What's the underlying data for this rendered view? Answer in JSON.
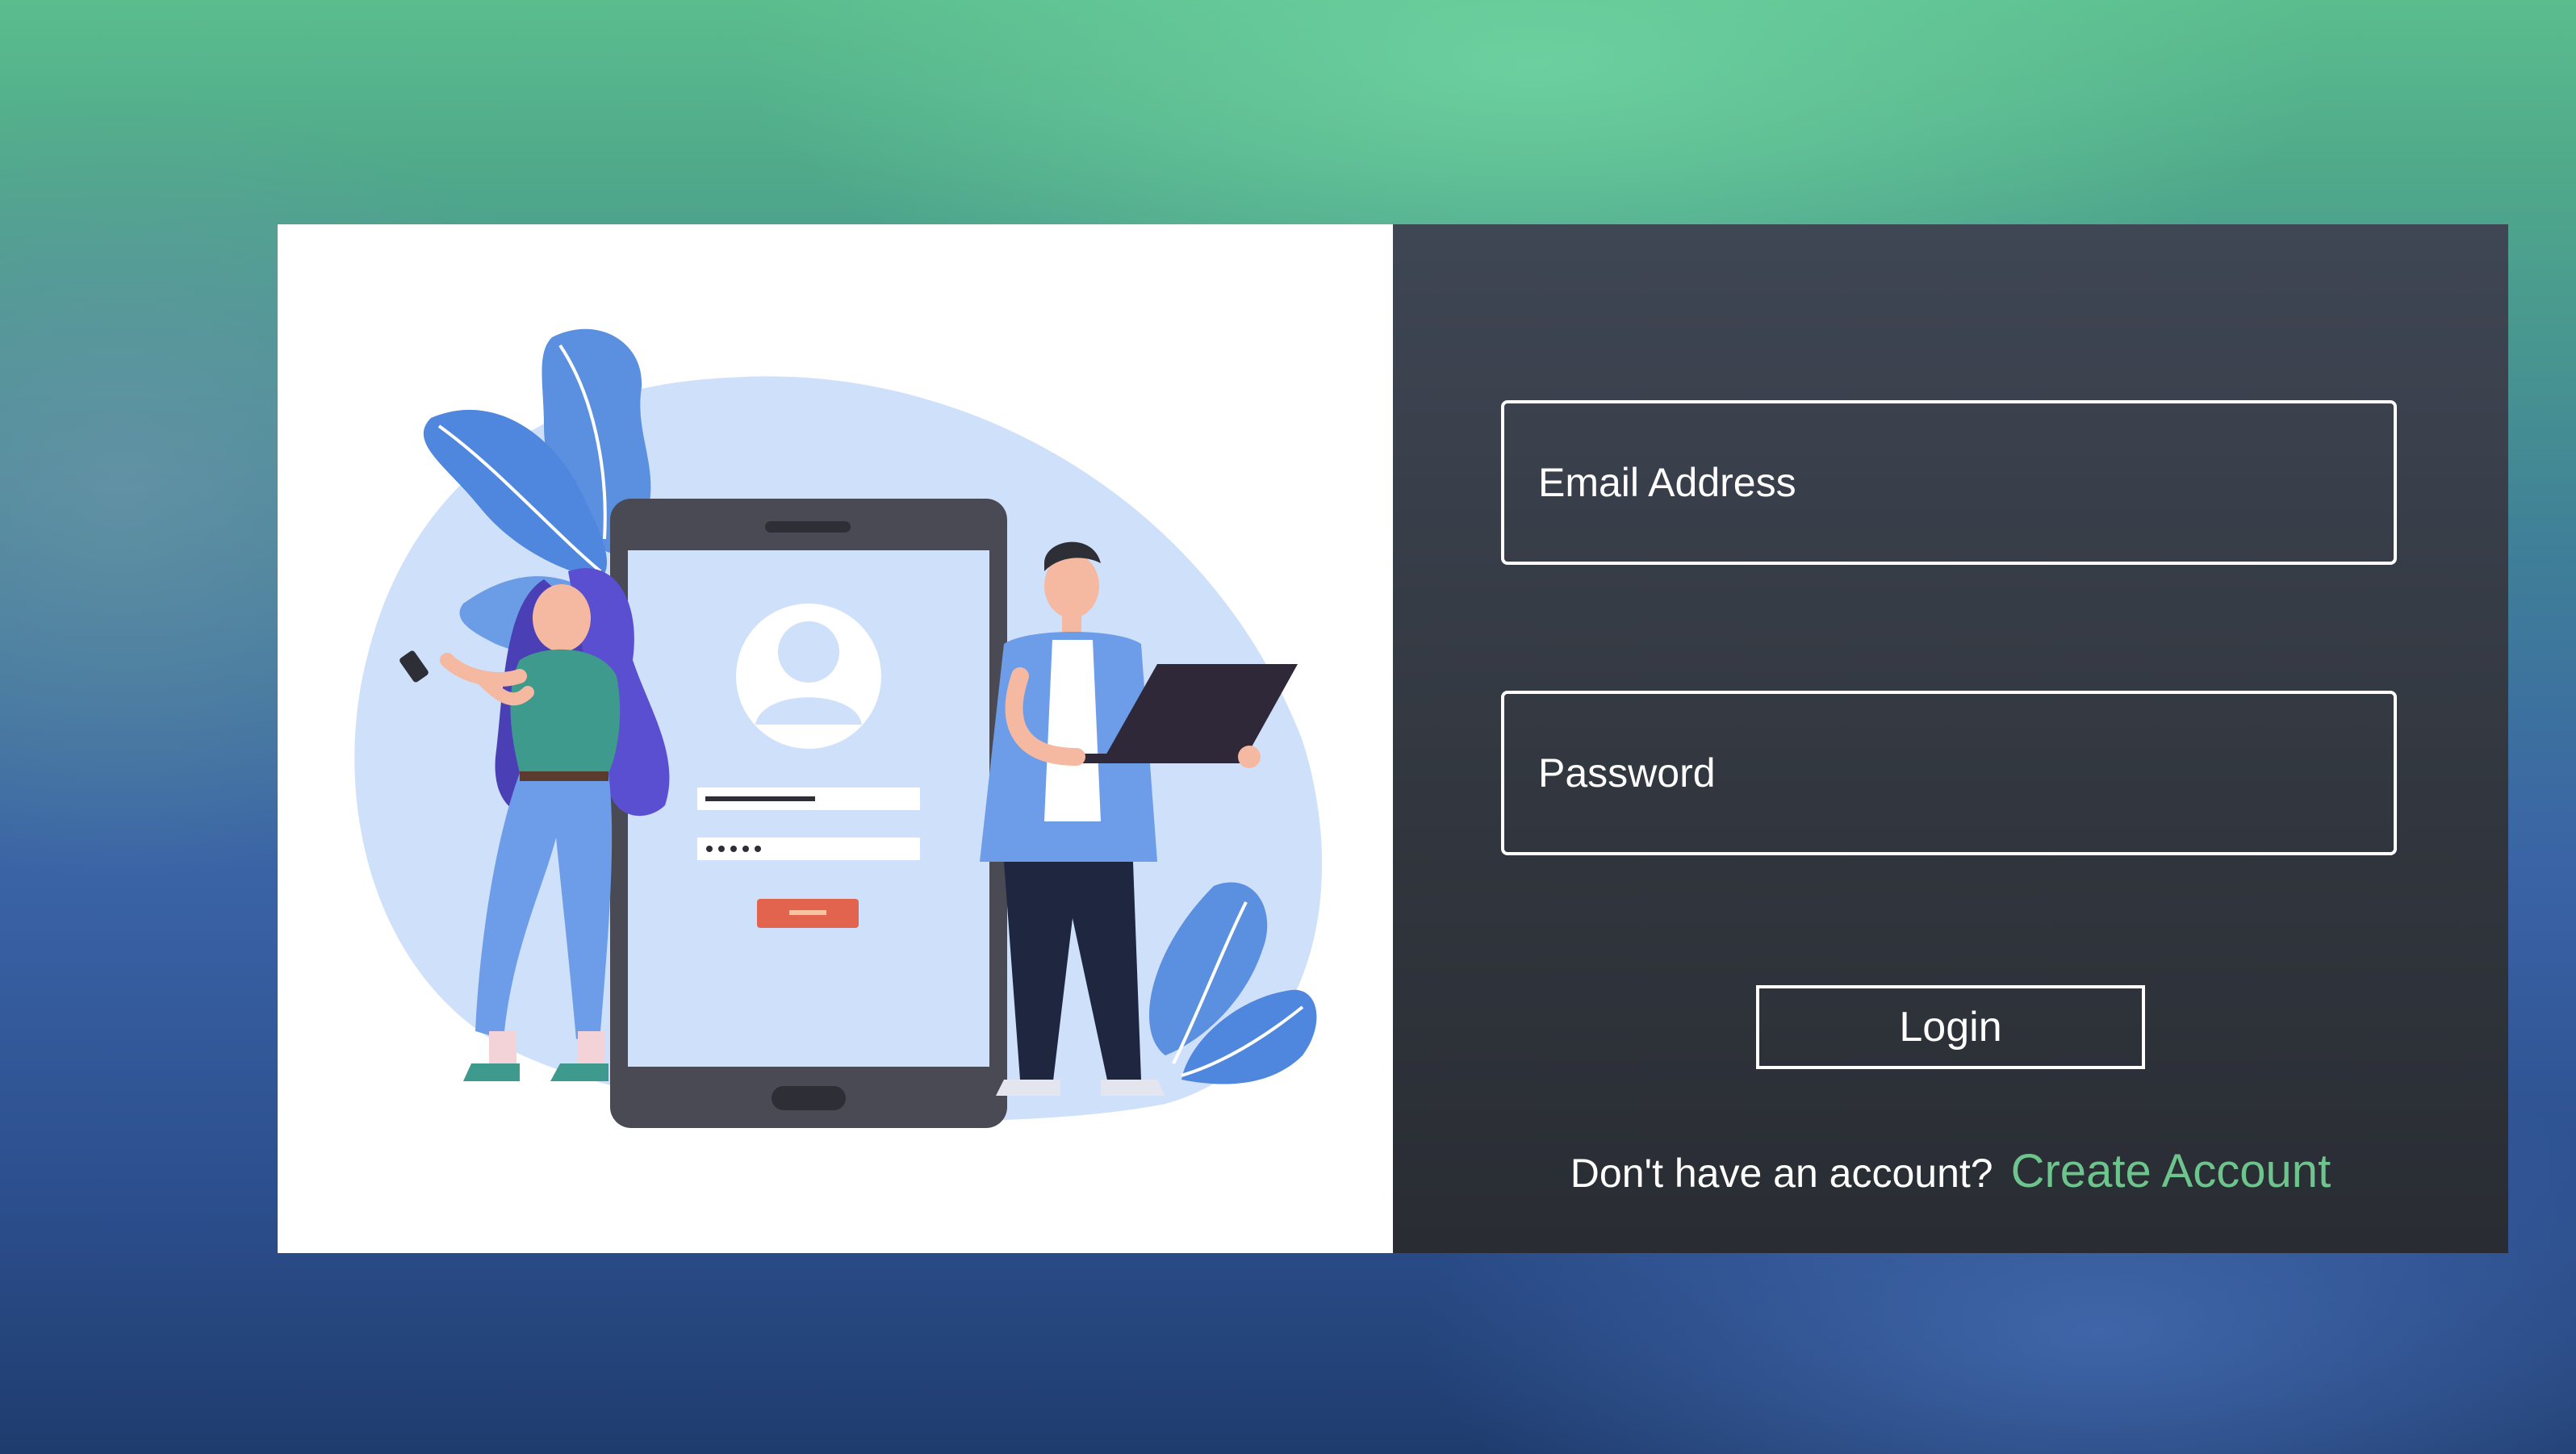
{
  "login_form": {
    "email_placeholder": "Email Address",
    "password_placeholder": "Password",
    "login_label": "Login",
    "signup_prompt": "Don't have an account?",
    "create_account_label": "Create Account"
  },
  "colors": {
    "accent": "#6dc48c",
    "form_panel_top": "#3f4654",
    "form_panel_bottom": "#292c33",
    "illustration_blue": "#5b8fe0",
    "illustration_bg_blob": "#cfe0fb"
  },
  "illustration": {
    "icons": [
      "person-avatar-icon",
      "smartphone-icon",
      "laptop-icon",
      "leaf-icon"
    ]
  }
}
